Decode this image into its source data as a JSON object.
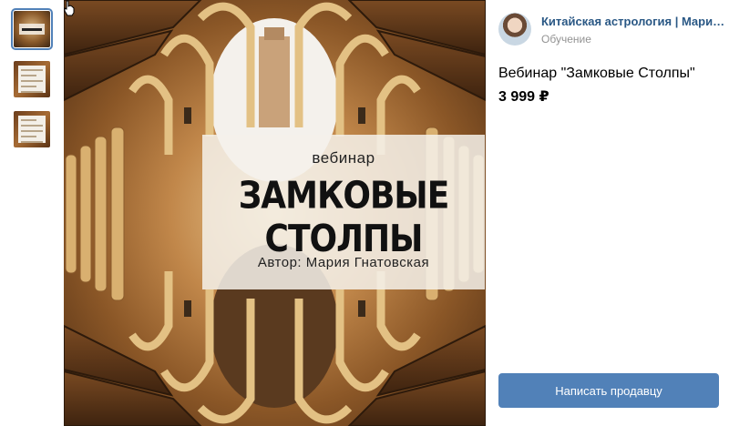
{
  "seller": {
    "name": "Китайская астрология | Мария Гнатовская",
    "category": "Обучение"
  },
  "product": {
    "title": "Вебинар \"Замковые Столпы\"",
    "price": "3 999 ₽"
  },
  "poster": {
    "subtitle": "вебинар",
    "title": "ЗАМКОВЫЕ СТОЛПЫ",
    "author": "Автор: Мария Гнатовская"
  },
  "actions": {
    "contact_seller": "Написать продавцу"
  },
  "colors": {
    "accent": "#5181b8",
    "link": "#2a5885",
    "muted": "#939393"
  }
}
